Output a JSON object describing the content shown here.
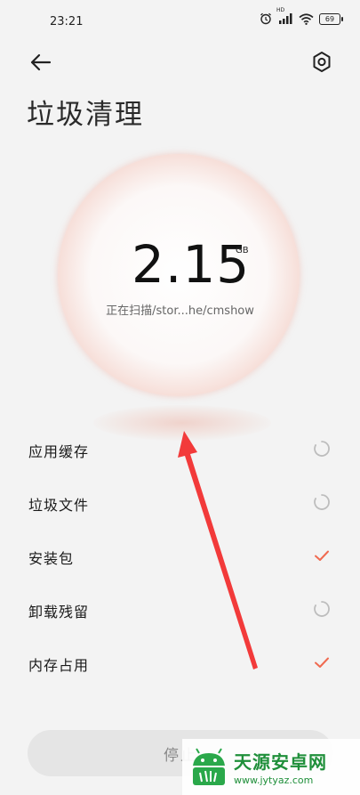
{
  "status_bar": {
    "time": "23:21",
    "network_label": "HD",
    "battery": "69"
  },
  "header": {
    "title": "垃圾清理"
  },
  "scan": {
    "size_value": "2.15",
    "size_unit": "GB",
    "path": "正在扫描/stor...he/cmshow"
  },
  "items": [
    {
      "label": "应用缓存",
      "status": "loading"
    },
    {
      "label": "垃圾文件",
      "status": "loading"
    },
    {
      "label": "安装包",
      "status": "done"
    },
    {
      "label": "卸载残留",
      "status": "loading"
    },
    {
      "label": "内存占用",
      "status": "done"
    }
  ],
  "stop_button": {
    "label": "停止"
  },
  "watermark": {
    "name": "天源安卓网",
    "url": "www.jytyaz.com"
  },
  "colors": {
    "accent": "#f06a50",
    "spinner": "#bdbdbd",
    "annotation_arrow": "#f23a3a",
    "watermark_green": "#1f8f3a"
  }
}
